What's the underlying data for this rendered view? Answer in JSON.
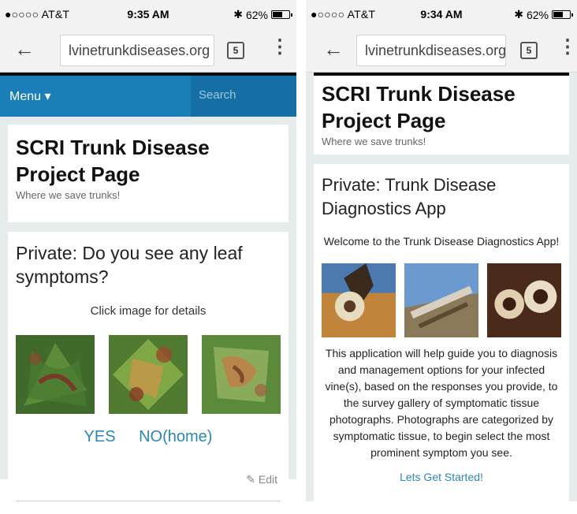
{
  "left": {
    "status": {
      "carrier": "●○○○○ AT&T",
      "time": "9:35 AM",
      "battery": "62%",
      "battery_level": 0.62
    },
    "browser": {
      "url": "lvinetrunkdiseases.org",
      "tab_count": "5"
    },
    "nav": {
      "menu_label": "Menu",
      "search_placeholder": "Search"
    },
    "site": {
      "title": "SCRI Trunk Disease Project Page",
      "tagline": "Where we save trunks!"
    },
    "post": {
      "title": "Private: Do you see any leaf symptoms?",
      "caption": "Click image for details",
      "yes_label": "YES",
      "no_label": "NO(home)",
      "edit_label": "Edit"
    }
  },
  "right": {
    "status": {
      "carrier": "●○○○○ AT&T",
      "time": "9:34 AM",
      "battery": "62%",
      "battery_level": 0.62
    },
    "browser": {
      "url": "lvinetrunkdiseases.org",
      "tab_count": "5"
    },
    "site": {
      "title": "SCRI Trunk Disease Project Page",
      "tagline": "Where we save trunks!"
    },
    "post": {
      "title": "Private: Trunk Disease Diagnostics App",
      "welcome": "Welcome to the Trunk Disease Diagnostics App!",
      "description": "This application will help guide you to diagnosis and management options for your infected vine(s), based on the responses you provide, to the survey gallery of symptomatic tissue photographs. Photographs are categorized by symptomatic tissue, to begin select the most prominent symptom you see.",
      "cta_label": "Lets Get Started!"
    }
  },
  "colors": {
    "nav_blue": "#1a7fb8",
    "link_blue": "#2b87b6",
    "page_bg": "#e6ebeb"
  }
}
